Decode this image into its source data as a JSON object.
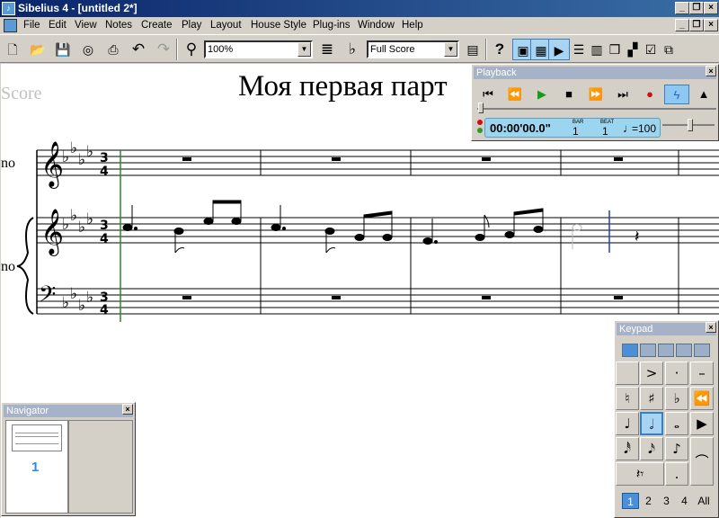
{
  "window": {
    "title": "Sibelius 4 - [untitled 2*]"
  },
  "menu": [
    "File",
    "Edit",
    "View",
    "Notes",
    "Create",
    "Play",
    "Layout",
    "House Style",
    "Plug-ins",
    "Window",
    "Help"
  ],
  "toolbar": {
    "zoom_value": "100%",
    "view_value": "Full Score"
  },
  "score": {
    "watermark": "Score",
    "title": "Моя первая парт",
    "instrument_top": "no",
    "instrument_piano": "no"
  },
  "playback": {
    "title": "Playback",
    "time": "00:00'00.0\"",
    "bar_label": "BAR",
    "bar_value": "1",
    "beat_label": "BEAT",
    "beat_value": "1",
    "tempo": "=100"
  },
  "navigator": {
    "title": "Navigator",
    "page_number": "1"
  },
  "keypad": {
    "title": "Keypad",
    "layouts": [
      "1",
      "2",
      "3",
      "4",
      "All"
    ],
    "selected_layout": "1"
  },
  "colors": {
    "title_bar": "#0a246a",
    "accent": "#4a90d8",
    "play": "#1a9a1a",
    "record": "#d01010"
  }
}
